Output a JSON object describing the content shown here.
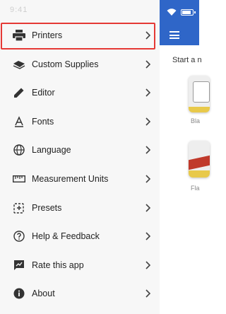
{
  "status_bar": {
    "time": "9:41",
    "icons": [
      "wifi-icon",
      "battery-icon"
    ]
  },
  "app": {
    "toolbar_icon": "menu-icon",
    "start_label": "Start a n",
    "cards": [
      {
        "label": "Bla"
      },
      {
        "label": "Fla"
      }
    ]
  },
  "drawer": {
    "items": [
      {
        "label": "Printers",
        "icon": "printer-icon",
        "highlighted": true
      },
      {
        "label": "Custom Supplies",
        "icon": "supplies-icon"
      },
      {
        "label": "Editor",
        "icon": "pencil-icon"
      },
      {
        "label": "Fonts",
        "icon": "font-icon"
      },
      {
        "label": "Language",
        "icon": "globe-icon"
      },
      {
        "label": "Measurement Units",
        "icon": "ruler-icon"
      },
      {
        "label": "Presets",
        "icon": "presets-icon"
      },
      {
        "label": "Help & Feedback",
        "icon": "help-icon"
      },
      {
        "label": "Rate this app",
        "icon": "rate-icon"
      },
      {
        "label": "About",
        "icon": "info-icon"
      }
    ]
  },
  "colors": {
    "app_bar": "#2f66c8",
    "highlight": "#e53935",
    "drawer_bg": "#f7f7f7"
  }
}
